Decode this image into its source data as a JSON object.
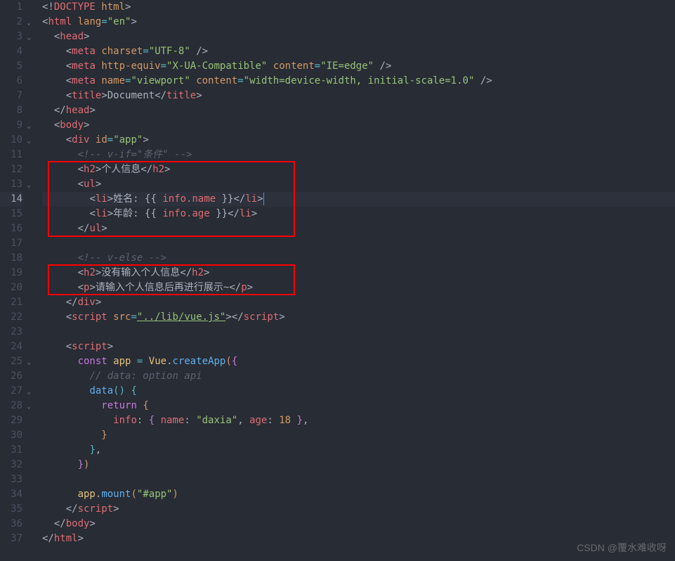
{
  "lines": {
    "n1": "1",
    "n2": "2",
    "n3": "3",
    "n4": "4",
    "n5": "5",
    "n6": "6",
    "n7": "7",
    "n8": "8",
    "n9": "9",
    "n10": "10",
    "n11": "11",
    "n12": "12",
    "n13": "13",
    "n14": "14",
    "n15": "15",
    "n16": "16",
    "n17": "17",
    "n18": "18",
    "n19": "19",
    "n20": "20",
    "n21": "21",
    "n22": "22",
    "n23": "23",
    "n24": "24",
    "n25": "25",
    "n26": "26",
    "n27": "27",
    "n28": "28",
    "n29": "29",
    "n30": "30",
    "n31": "31",
    "n32": "32",
    "n33": "33",
    "n34": "34",
    "n35": "35",
    "n36": "36",
    "n37": "37"
  },
  "code": {
    "doctype_open": "<!",
    "doctype": "DOCTYPE",
    "html_sp": " html",
    "close_bang": ">",
    "lt": "<",
    "gt": ">",
    "lts": "</",
    "sgt": " />",
    "html": "html",
    "head": "head",
    "meta": "meta",
    "title": "title",
    "body": "body",
    "div": "div",
    "h2": "h2",
    "ul": "ul",
    "li": "li",
    "p": "p",
    "script": "script",
    "lang": "lang",
    "en": "\"en\"",
    "charset": "charset",
    "utf8": "\"UTF-8\"",
    "httpequiv": "http-equiv",
    "xua": "\"X-UA-Compatible\"",
    "content": "content",
    "ieedge": "\"IE=edge\"",
    "name": "name",
    "viewport": "\"viewport\"",
    "vpcontent": "\"width=device-width, initial-scale=1.0\"",
    "id": "id",
    "app": "\"app\"",
    "src": "src",
    "vuejs": "\"../lib/vue.js\"",
    "title_text": "Document",
    "cmt_vif": "<!-- v-if=\"条件\" -->",
    "h2_info": "个人信息",
    "li_name_label": "姓名: ",
    "li_age_label": "年龄: ",
    "mustache_open": "{{ ",
    "mustache_close": " }}",
    "info_name": "info.name",
    "info_age": "info.age",
    "cmt_velse": "<!-- v-else -->",
    "h2_noinfo": "没有输入个人信息",
    "p_noinfo": "请输入个人信息后再进行展示~",
    "const": "const",
    "app_var": "app",
    "eq": " = ",
    "Vue": "Vue",
    "dot": ".",
    "createApp": "createApp",
    "paren_o": "(",
    "paren_c": ")",
    "brace_o": "{",
    "brace_c": "}",
    "bracket_o": "[",
    "bracket_c": "]",
    "comma": ",",
    "cmt_data": "// data: option api",
    "data": "data",
    "return": "return",
    "info": "info",
    "colon": ": ",
    "name_k": "name",
    "daxia": "\"daxia\"",
    "age_k": "age",
    "eighteen": "18",
    "mount": "mount",
    "appsel": "\"#app\""
  },
  "watermark": "CSDN @覆水难收呀"
}
